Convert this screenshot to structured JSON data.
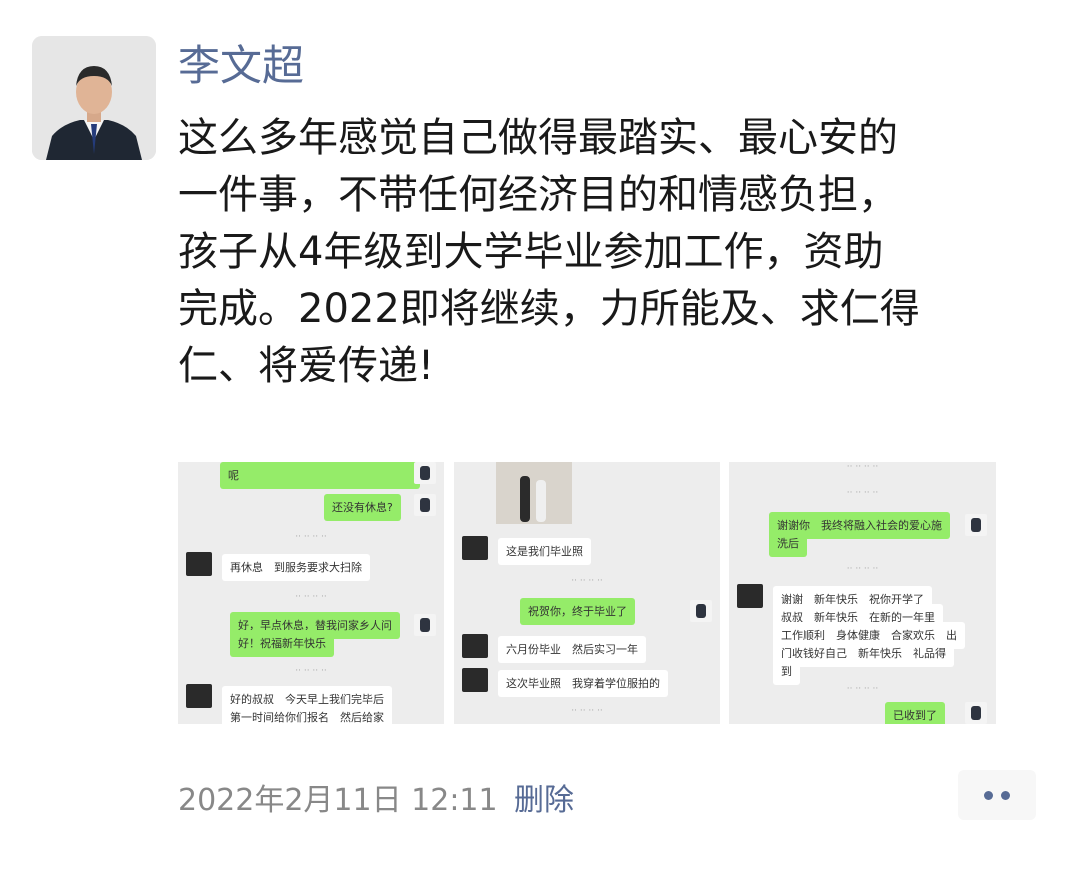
{
  "post": {
    "author": "李文超",
    "text_lines": [
      "这么多年感觉自己做得最踏实、最心安的",
      "一件事，不带任何经济目的和情感负担，",
      "孩子从4年级到大学毕业参加工作，资助",
      "完成。2022即将继续，力所能及、求仁得",
      "仁、将爱传递!"
    ],
    "timestamp": "2022年2月11日 12:11",
    "delete_label": "删除"
  },
  "images": [
    {
      "bubbles": [
        {
          "text": "呢",
          "kind": "green"
        },
        {
          "text": "还没有休息?",
          "kind": "green"
        },
        {
          "text": "再休息　到服务要求大扫除",
          "kind": "white"
        },
        {
          "text": "好，早点休息，替我问家乡人问",
          "kind": "green"
        },
        {
          "text": "好！祝福新年快乐",
          "kind": "green"
        },
        {
          "text": "好的叔叔　今天早上我们完毕后",
          "kind": "white"
        },
        {
          "text": "第一时间给你们报名　然后给家",
          "kind": "white"
        }
      ]
    },
    {
      "bubbles": [
        {
          "text": "这是我们毕业照",
          "kind": "white"
        },
        {
          "text": "祝贺你，终于毕业了",
          "kind": "green"
        },
        {
          "text": "六月份毕业　然后实习一年",
          "kind": "white"
        },
        {
          "text": "这次毕业照　我穿着学位服拍的",
          "kind": "white"
        }
      ]
    },
    {
      "bubbles": [
        {
          "text": "谢谢你　我终将融入社会的爱心施",
          "kind": "green"
        },
        {
          "text": "洗后",
          "kind": "green"
        },
        {
          "text": "谢谢　新年快乐　祝你开学了",
          "kind": "white"
        },
        {
          "text": "叔叔　新年快乐　在新的一年里",
          "kind": "white"
        },
        {
          "text": "工作顺利　身体健康　合家欢乐　出",
          "kind": "white"
        },
        {
          "text": "门收钱好自己　新年快乐　礼品得",
          "kind": "white"
        },
        {
          "text": "到",
          "kind": "white"
        },
        {
          "text": "已收到了",
          "kind": "green"
        }
      ]
    }
  ],
  "colors": {
    "link": "#576b95",
    "text": "#191919",
    "meta": "#888888",
    "chat_bg": "#ededed",
    "bubble_green": "#95ec69"
  },
  "icons": {
    "more": "more-options-icon"
  }
}
